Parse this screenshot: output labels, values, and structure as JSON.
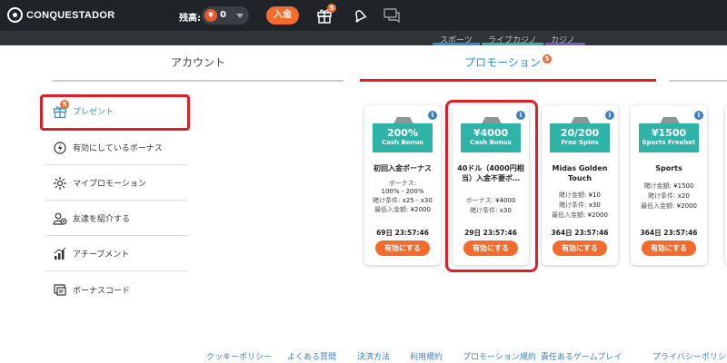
{
  "header": {
    "logo_text": "CONQUESTADOR",
    "balance_label": "残高:",
    "balance_currency_glyph": "¥",
    "balance_value": "0",
    "deposit_label": "入金",
    "gift_badge": "5"
  },
  "subnav": {
    "tabs": [
      {
        "label": "スポーツ",
        "color": "#2e8bd6"
      },
      {
        "label": "ライブカジノ",
        "color": "#2eb4a7"
      },
      {
        "label": "カジノ",
        "color": "#7a57c8"
      }
    ]
  },
  "tabs": {
    "account": "アカウント",
    "promotion": "プロモーション",
    "promotion_badge": "5"
  },
  "sidebar": {
    "items": [
      {
        "label": "プレゼント",
        "badge": "5",
        "icon": "gift-icon",
        "active": true
      },
      {
        "label": "有効にしているボーナス",
        "icon": "active-bonus-icon"
      },
      {
        "label": "マイプロモーション",
        "icon": "my-promotion-icon"
      },
      {
        "label": "友達を紹介する",
        "icon": "refer-friend-icon"
      },
      {
        "label": "アチーブメント",
        "icon": "achievement-icon"
      },
      {
        "label": "ボーナスコード",
        "icon": "bonus-code-icon"
      }
    ]
  },
  "cards": [
    {
      "amount": "200%",
      "kind": "Cash Bonus",
      "title": "初回入金ボーナス",
      "details": [
        {
          "label": "ボーナス:",
          "value": ""
        },
        {
          "label": "",
          "value": "100% - 200%"
        },
        {
          "label": "賭け条件:",
          "value": "x25 - x30"
        },
        {
          "label": "最低入金額:",
          "value": "¥2000"
        }
      ],
      "timer": "69日  23:57:46",
      "button": "有効にする"
    },
    {
      "amount": "¥4000",
      "kind": "Cash Bonus",
      "title": "40ドル（4000円相当）入金不要ボ…",
      "details": [
        {
          "label": "ボーナス:",
          "value": "¥4000"
        },
        {
          "label": "賭け条件:",
          "value": "x30"
        }
      ],
      "timer": "29日  23:57:46",
      "button": "有効にする"
    },
    {
      "amount": "20/200",
      "kind": "Free Spins",
      "title": "Midas Golden Touch",
      "details": [
        {
          "label": "賭け金額:",
          "value": "¥10"
        },
        {
          "label": "賭け条件:",
          "value": "x30"
        },
        {
          "label": "最低入金額:",
          "value": "¥2000"
        }
      ],
      "timer": "364日  23:57:46",
      "button": "有効にする"
    },
    {
      "amount": "¥1500",
      "kind": "Sports Freebet",
      "title": "Sports",
      "details": [
        {
          "label": "賭け金額:",
          "value": "¥1500"
        },
        {
          "label": "賭け条件:",
          "value": "x20"
        },
        {
          "label": "最低入金額:",
          "value": "¥2000"
        }
      ],
      "timer": "364日  23:57:46",
      "button": "有効にする"
    }
  ],
  "footer": {
    "links": [
      "クッキーポリシー",
      "よくある質問",
      "決済方法",
      "利用規約",
      "プロモーション規約",
      "責任あるゲームプレイ",
      "プライバシーポリシー"
    ]
  },
  "colors": {
    "accent_orange": "#f36c2e",
    "banner_teal": "#2eb4a7",
    "link_blue": "#2e8bd6",
    "highlight_red": "#e01e25",
    "header_bg": "#202428"
  }
}
